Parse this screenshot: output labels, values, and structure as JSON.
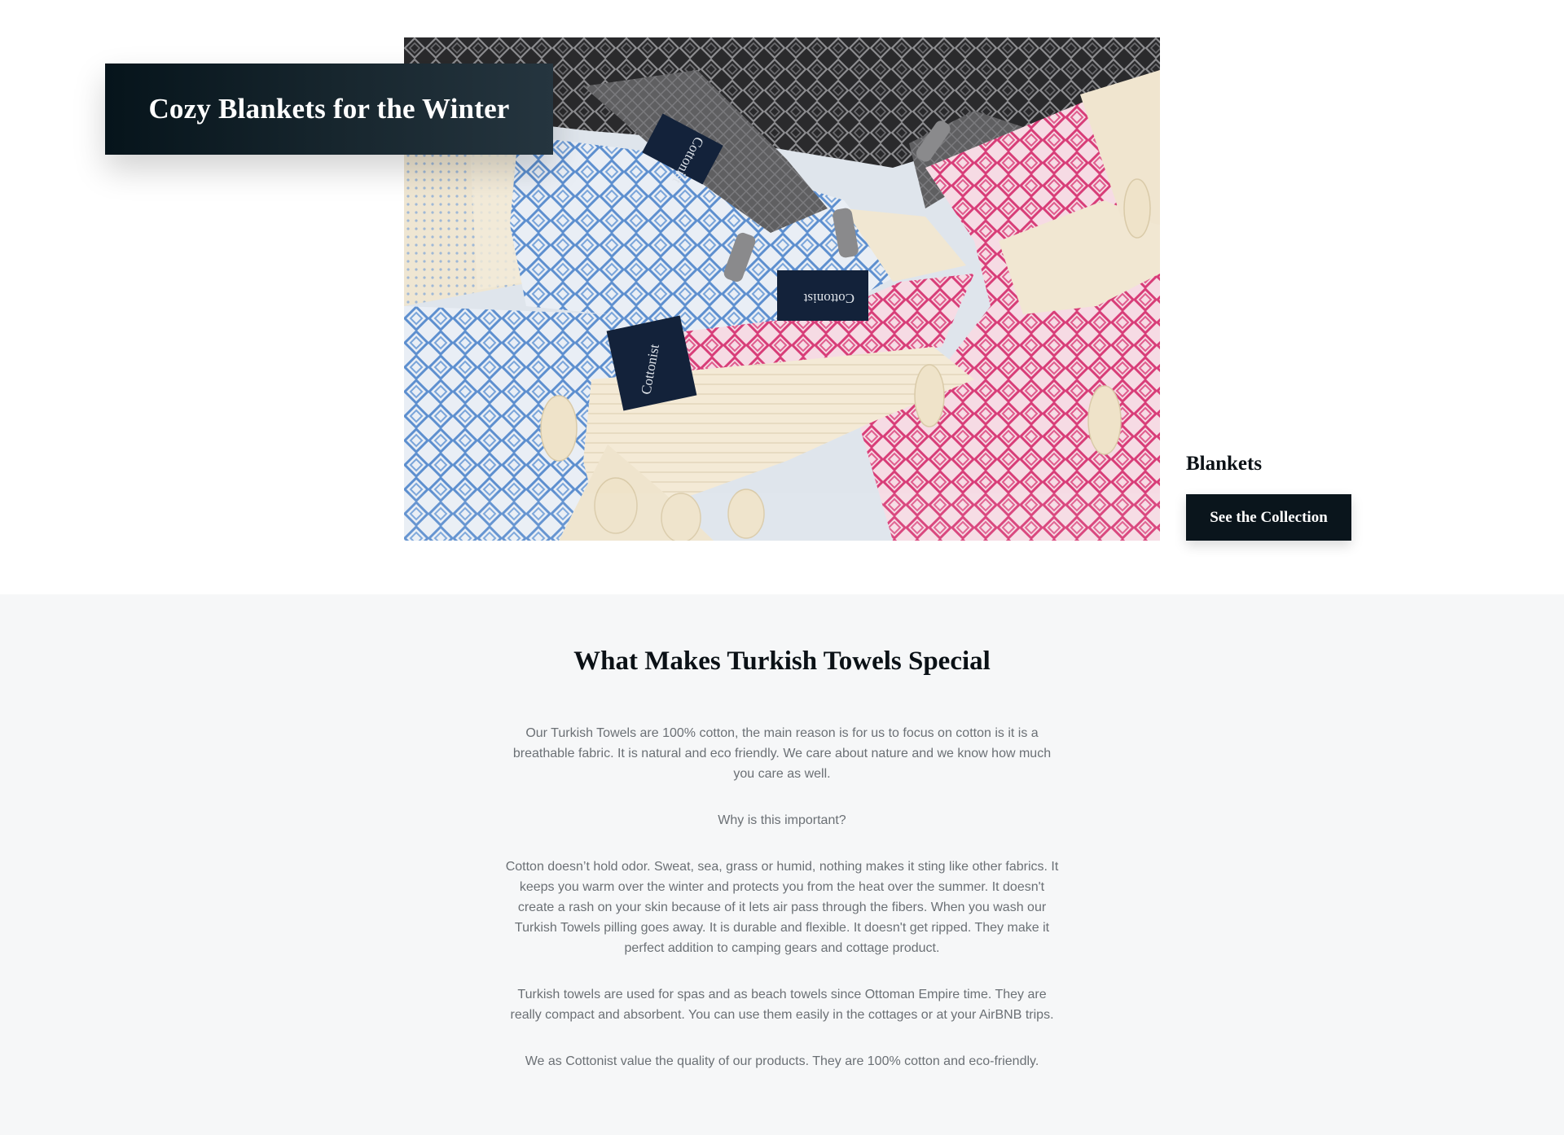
{
  "hero": {
    "title": "Cozy Blankets for the Winter",
    "image_description_icon": "blankets-photo",
    "image_tags": [
      "Cottonist",
      "Cottonist",
      "Cottonist"
    ],
    "collection_label": "Blankets",
    "collection_button": "See the Collection"
  },
  "info": {
    "heading": "What Makes Turkish Towels Special",
    "paragraphs": [
      "Our Turkish Towels are 100% cotton, the main reason is for us to focus on cotton is it is a breathable fabric. It is natural and eco friendly. We care about nature and we know how much you care as well.",
      "Why is this important?",
      "Cotton doesn’t hold odor. Sweat, sea, grass or humid, nothing makes it sting like other fabrics. It keeps you warm over the winter and protects you from the heat over the summer. It doesn't create a rash on your skin because of it lets air pass through the fibers. When you wash our Turkish Towels pilling goes away. It is durable and flexible. It doesn't get ripped. They make it perfect addition to camping gears and cottage product.",
      "Turkish towels are used for spas and as beach towels since Ottoman Empire time. They are really compact and absorbent. You can use them easily in the cottages or at your AirBNB trips.",
      "We as Cottonist value the quality of our products. They are 100% cotton and eco-friendly."
    ]
  },
  "colors": {
    "dark_accent": "#0a151c",
    "section_bg": "#f6f7f8",
    "body_text": "#6b7075"
  }
}
